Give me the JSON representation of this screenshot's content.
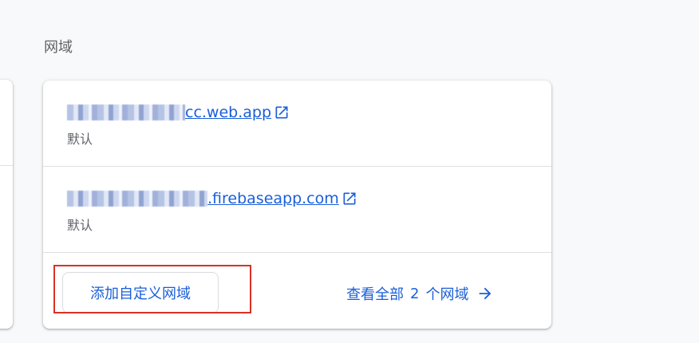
{
  "section": {
    "title": "网域"
  },
  "domains": [
    {
      "suffix": "cc.web.app",
      "label": "默认",
      "icon": "open-in-new-icon"
    },
    {
      "suffix": ".firebaseapp.com",
      "label": "默认",
      "icon": "open-in-new-icon"
    }
  ],
  "footer": {
    "add_button_label": "添加自定义网域",
    "view_all_prefix": "查看全部",
    "view_all_count": "2",
    "view_all_suffix": "个网域",
    "arrow_icon": "arrow-forward-icon"
  },
  "colors": {
    "link": "#1a5fd8",
    "highlight": "#d93025",
    "secondary_text": "#5f6368",
    "background": "#f8f9fa"
  }
}
